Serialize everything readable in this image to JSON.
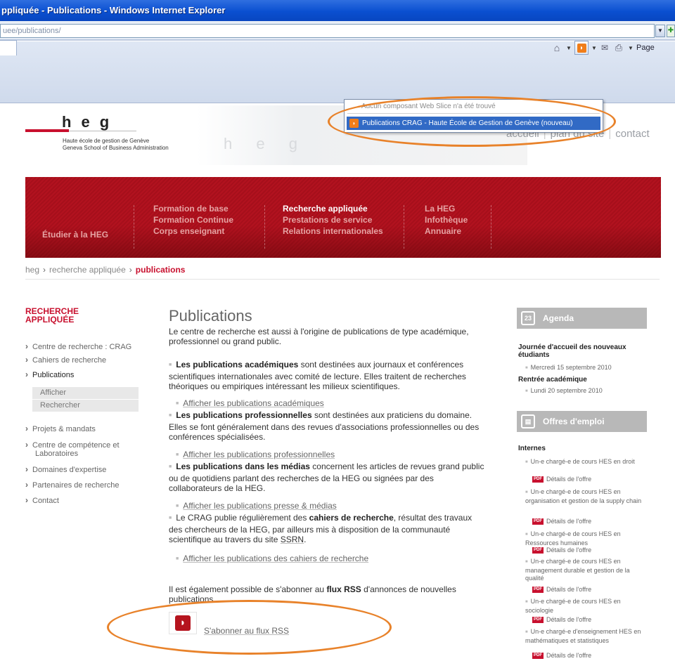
{
  "browser": {
    "title": "ppliquée - Publications - Windows Internet Explorer",
    "address": "uee/publications/",
    "page_label": "Page"
  },
  "feed_menu": {
    "none_text": "Aucun composant Web Slice n'a été trouvé",
    "item": "Publications CRAG - Haute École de Gestion de Genève (nouveau)"
  },
  "header": {
    "logo_letters": [
      "h",
      "e",
      "g"
    ],
    "school_fr": "Haute école de gestion de Genève",
    "school_en": "Geneva School of Business Administration",
    "ghost_letters": "h e g",
    "links": [
      "accueil",
      "plan du site",
      "contact"
    ]
  },
  "nav": {
    "col1": [
      "Étudier à la HEG"
    ],
    "col2": [
      "Formation de base",
      "Formation Continue",
      "Corps enseignant"
    ],
    "col3": [
      "Recherche appliquée",
      "Prestations de service",
      "Relations internationales"
    ],
    "col4": [
      "La HEG",
      "Infothèque",
      "Annuaire"
    ]
  },
  "breadcrumb": [
    "heg",
    "recherche appliquée",
    "publications"
  ],
  "sidebar": {
    "title_line1": "RECHERCHE",
    "title_line2": "APPLIQUÉE",
    "items": [
      "Centre de recherche : CRAG",
      "Cahiers de recherche",
      "Publications",
      "Projets & mandats",
      "Centre de compétence et",
      "Laboratoires",
      "Domaines d'expertise",
      "Partenaires de recherche",
      "Contact"
    ],
    "sub": [
      "Afficher",
      "Rechercher"
    ]
  },
  "main": {
    "title": "Publications",
    "intro": "Le centre de recherche est aussi à l'origine de publications de type académique, professionnel ou grand public.",
    "academic_bold": "Les publications académiques",
    "academic_text": " sont destinées aux journaux et conférences scientifiques internationales avec comité de lecture. Elles traitent de recherches théoriques ou empiriques intéressant les milieux scientifiques.",
    "academic_link": "Afficher les publications académiques",
    "pro_bold": "Les publications professionnelles",
    "pro_text": " sont destinées aux praticiens du domaine. Elles se font généralement dans des revues d'associations professionnelles ou des conférences spécialisées.",
    "pro_link": "Afficher les publications professionnelles",
    "media_bold": "Les publications dans les médias",
    "media_text": " concernent les articles de revues grand public ou de quotidiens parlant des recherches de la HEG ou signées par des collaborateurs de la HEG.",
    "media_link": "Afficher les publications presse & médias",
    "crag_text1": "Le CRAG publie régulièrement des ",
    "crag_bold": "cahiers de recherche",
    "crag_text2": ", résultat des travaux des chercheurs de la HEG, par ailleurs mis à disposition de la communauté scientifique au travers du site ",
    "crag_ssrn": "SSRN",
    "crag_text3": ".",
    "cahiers_link": "Afficher les publications des cahiers de recherche",
    "rss_text1": "Il est également possible de s'abonner au ",
    "rss_bold": "flux RSS",
    "rss_text2": " d'annonces de nouvelles publications.",
    "rss_subscribe": "S'abonner au flux RSS"
  },
  "agenda": {
    "title": "Agenda",
    "icon_text": "23",
    "events": [
      {
        "title": "Journée d'accueil des nouveaux étudiants",
        "date": "Mercredi 15 septembre 2010"
      },
      {
        "title": "Rentrée académique",
        "date": "Lundi 20 septembre 2010"
      }
    ]
  },
  "jobs": {
    "title": "Offres d'emploi",
    "section": "Internes",
    "details": "Détails de l'offre",
    "pdf_label": "PDF",
    "items": [
      "Un-e chargé-e de cours HES en droit",
      "Un-e chargé-e de cours HES en organisation et gestion de la supply chain",
      "Un-e chargé-e de cours HES en Ressources humaines",
      "Un-e chargé-e de cours HES en management durable et gestion de la qualité",
      "Un-e chargé-e de cours HES en sociologie",
      "Un-e chargé-e d'enseignement HES en mathématiques et statistiques"
    ]
  },
  "colors": {
    "brand_red": "#c8102e",
    "annotation": "#e8822a",
    "ie_blue": "#0a4fd0"
  }
}
